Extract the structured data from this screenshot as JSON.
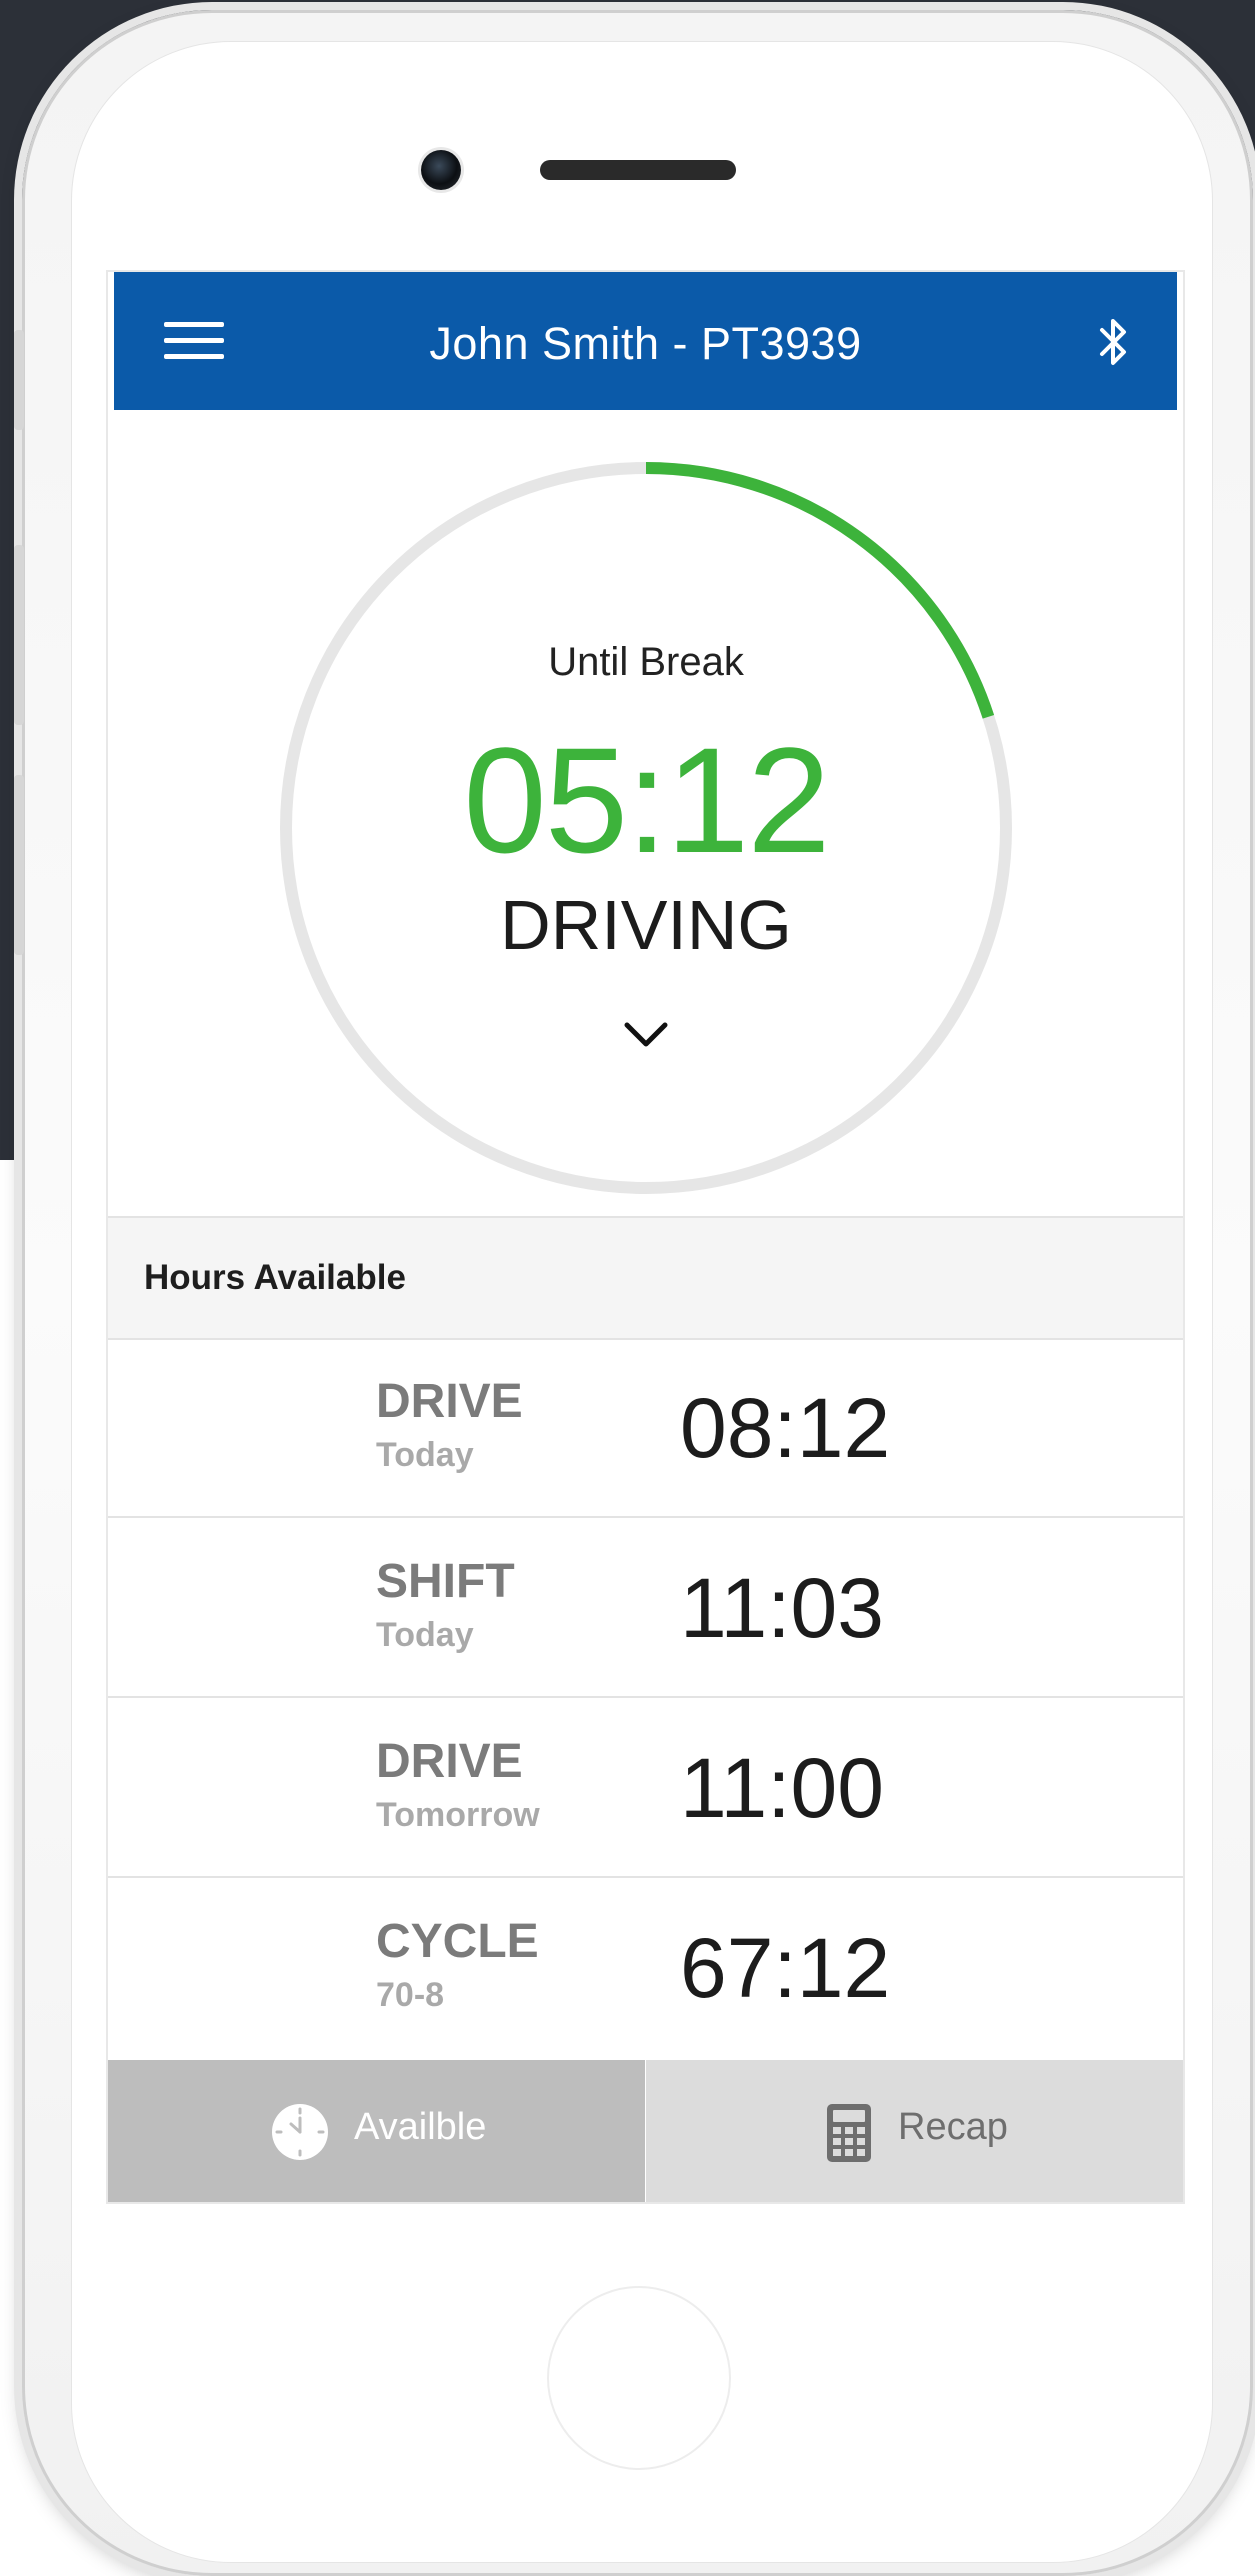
{
  "header": {
    "title": "John Smith - PT3939"
  },
  "timer": {
    "caption": "Until Break",
    "remaining": "05:12",
    "status": "DRIVING",
    "progress": 0.2
  },
  "hours": {
    "title": "Hours Available",
    "rows": [
      {
        "label": "DRIVE",
        "sub": "Today",
        "value": "08:12"
      },
      {
        "label": "SHIFT",
        "sub": "Today",
        "value": "11:03"
      },
      {
        "label": "DRIVE",
        "sub": "Tomorrow",
        "value": "11:00"
      },
      {
        "label": "CYCLE",
        "sub": "70-8",
        "value": "67:12"
      }
    ]
  },
  "tabs": [
    {
      "label": "Availble",
      "icon": "clock-icon",
      "active": true
    },
    {
      "label": "Recap",
      "icon": "calculator-icon",
      "active": false
    }
  ],
  "colors": {
    "header": "#0b5aa9",
    "accent": "#3db33b",
    "track": "#e6e6e6"
  }
}
